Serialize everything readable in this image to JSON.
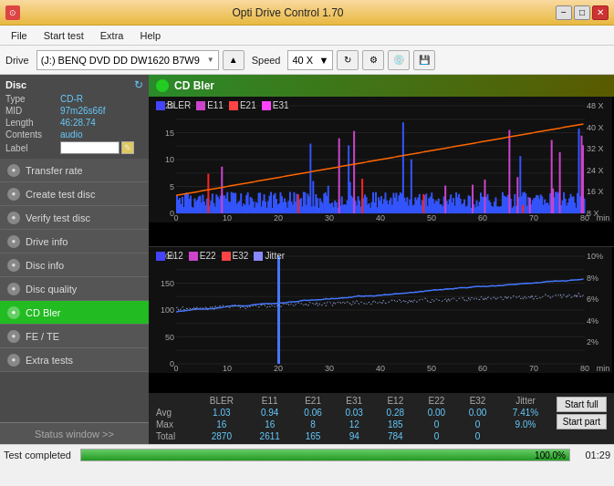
{
  "titleBar": {
    "title": "Opti Drive Control 1.70",
    "minimizeLabel": "−",
    "maximizeLabel": "□",
    "closeLabel": "✕"
  },
  "menuBar": {
    "items": [
      "File",
      "Start test",
      "Extra",
      "Help"
    ]
  },
  "toolbar": {
    "driveLabel": "Drive",
    "driveValue": "(J:)  BENQ DVD DD DW1620 B7W9",
    "speedLabel": "Speed",
    "speedValue": "40 X"
  },
  "disc": {
    "title": "Disc",
    "typeLabel": "Type",
    "typeValue": "CD-R",
    "midLabel": "MID",
    "midValue": "97m26s66f",
    "lengthLabel": "Length",
    "lengthValue": "46:28.74",
    "contentsLabel": "Contents",
    "contentsValue": "audio",
    "labelLabel": "Label",
    "labelValue": ""
  },
  "nav": {
    "items": [
      {
        "id": "transfer-rate",
        "label": "Transfer rate",
        "active": false
      },
      {
        "id": "create-test-disc",
        "label": "Create test disc",
        "active": false
      },
      {
        "id": "verify-test-disc",
        "label": "Verify test disc",
        "active": false
      },
      {
        "id": "drive-info",
        "label": "Drive info",
        "active": false
      },
      {
        "id": "disc-info",
        "label": "Disc info",
        "active": false
      },
      {
        "id": "disc-quality",
        "label": "Disc quality",
        "active": false
      },
      {
        "id": "cd-bler",
        "label": "CD Bler",
        "active": true
      },
      {
        "id": "fe-te",
        "label": "FE / TE",
        "active": false
      },
      {
        "id": "extra-tests",
        "label": "Extra tests",
        "active": false
      }
    ],
    "statusWindowLabel": "Status window >>"
  },
  "chart": {
    "title": "CD Bler",
    "upperLegend": [
      {
        "color": "#4444ff",
        "label": "BLER"
      },
      {
        "color": "#cc44cc",
        "label": "E11"
      },
      {
        "color": "#ff4444",
        "label": "E21"
      },
      {
        "color": "#ff44ff",
        "label": "E31"
      }
    ],
    "lowerLegend": [
      {
        "color": "#4444ff",
        "label": "E12"
      },
      {
        "color": "#cc44cc",
        "label": "E22"
      },
      {
        "color": "#ff4444",
        "label": "E32"
      },
      {
        "color": "#8888ff",
        "label": "Jitter"
      }
    ],
    "xLabel": "min",
    "upperYMax": "20",
    "lowerYMax": "200"
  },
  "stats": {
    "headers": [
      "",
      "BLER",
      "E11",
      "E21",
      "E31",
      "E12",
      "E22",
      "E32",
      "Jitter"
    ],
    "rows": [
      {
        "label": "Avg",
        "values": [
          "1.03",
          "0.94",
          "0.06",
          "0.03",
          "0.28",
          "0.00",
          "0.00",
          "7.41%"
        ]
      },
      {
        "label": "Max",
        "values": [
          "16",
          "16",
          "8",
          "12",
          "185",
          "0",
          "0",
          "9.0%"
        ]
      },
      {
        "label": "Total",
        "values": [
          "2870",
          "2611",
          "165",
          "94",
          "784",
          "0",
          "0",
          ""
        ]
      }
    ],
    "startFullLabel": "Start full",
    "startPartLabel": "Start part"
  },
  "statusBar": {
    "text": "Test completed",
    "progressPct": "100.0%",
    "progressValue": 100,
    "time": "01:29"
  }
}
